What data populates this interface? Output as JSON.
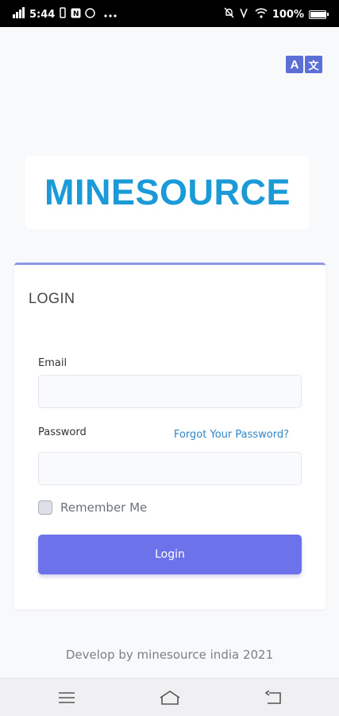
{
  "statusbar": {
    "time": "5:44",
    "battery_percent": "100%",
    "battery_level": 1.0,
    "left_icons": [
      "network-icon",
      "vibrate-icon",
      "notification-icon",
      "whatsapp-icon",
      "more-icon"
    ],
    "right_icons": [
      "mute-icon",
      "volte-icon",
      "wifi-icon",
      "battery-icon"
    ]
  },
  "language_button": {
    "icon": "translate-icon",
    "left_glyph": "A",
    "right_glyph": "文"
  },
  "logo": {
    "text": "MINESOURCE",
    "color": "#1a9ad6"
  },
  "login_card": {
    "title": "LOGIN",
    "email_label": "Email",
    "email_value": "",
    "password_label": "Password",
    "password_value": "",
    "forgot_link": "Forgot Your Password?",
    "remember_label": "Remember Me",
    "remember_checked": false,
    "login_button": "Login",
    "accent_color": "#6b72ea"
  },
  "footer": {
    "text": "Develop by minesource india 2021"
  },
  "navbar": {
    "icons": [
      "menu-icon",
      "home-icon",
      "back-icon"
    ]
  }
}
